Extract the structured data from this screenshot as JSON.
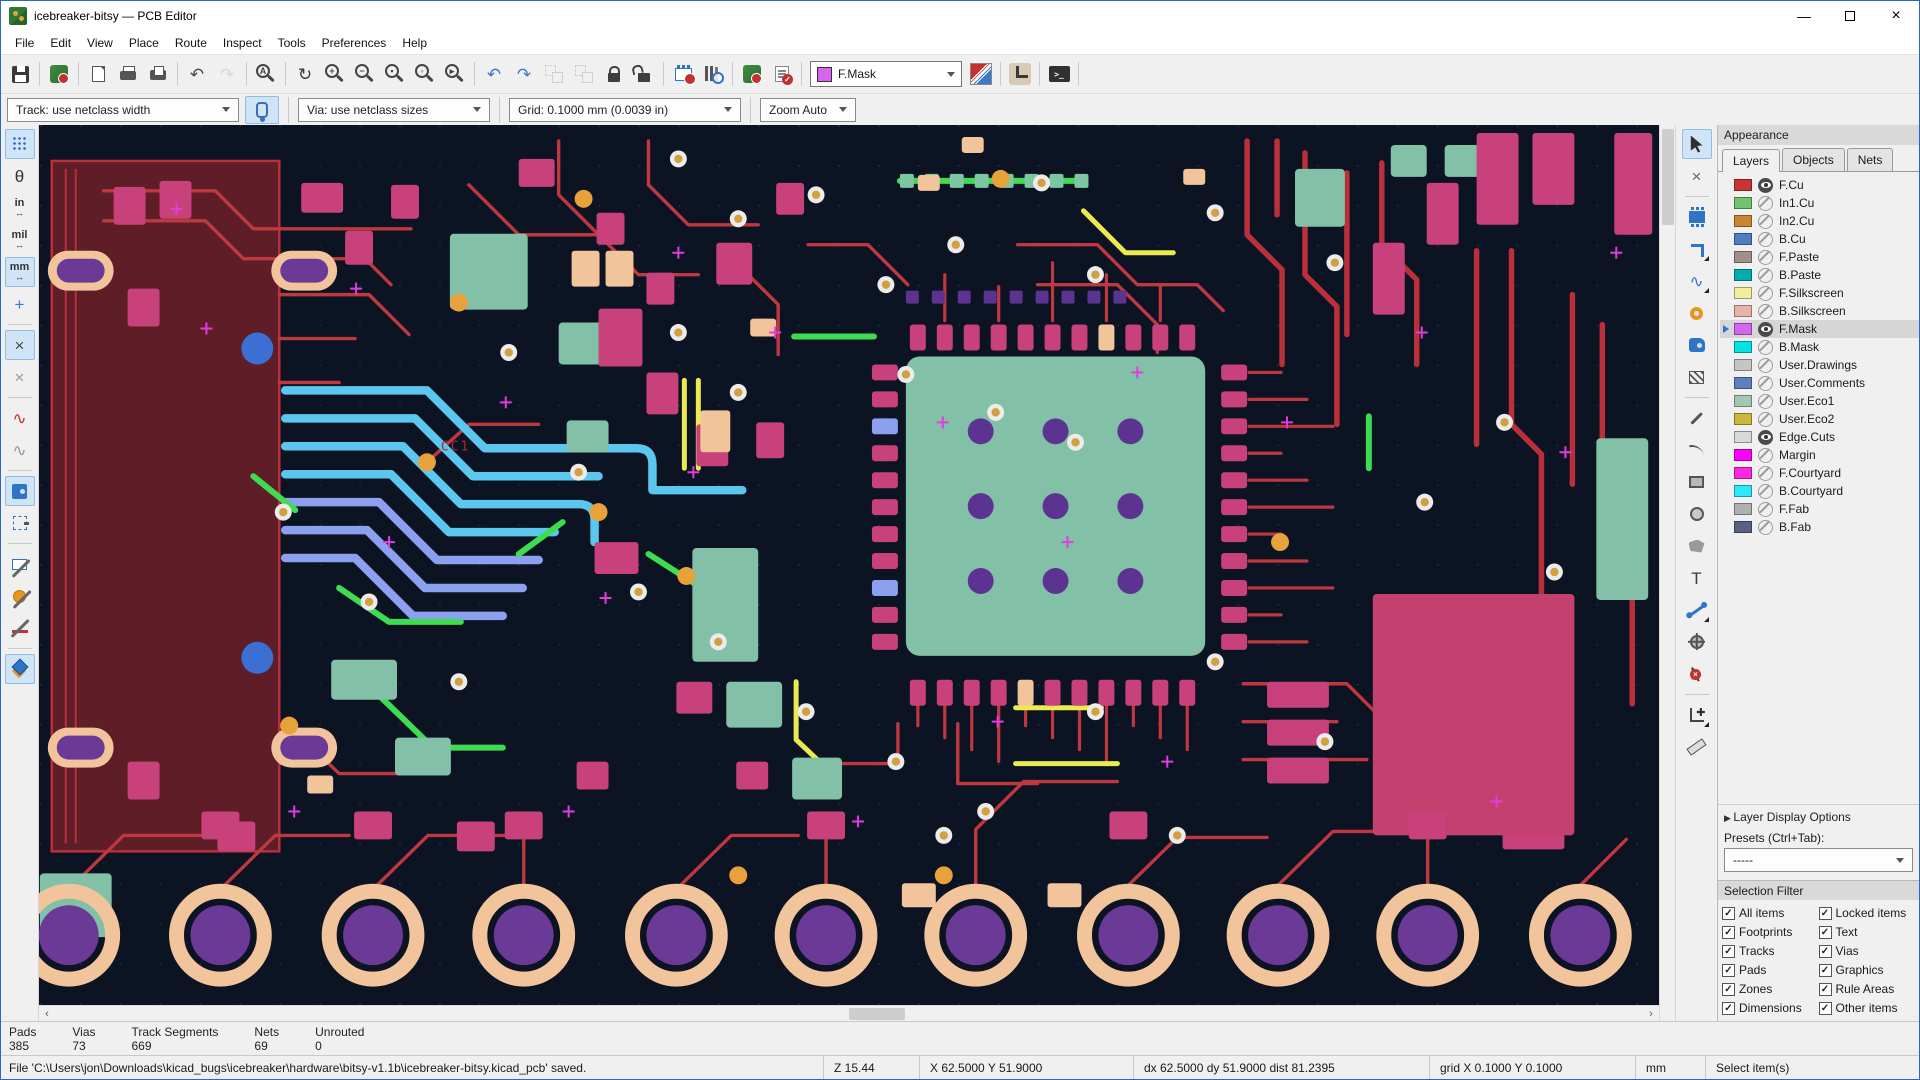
{
  "window": {
    "title": "icebreaker-bitsy — PCB Editor",
    "controls": {
      "minimize": "—",
      "close": "×"
    }
  },
  "menu": {
    "items": [
      "File",
      "Edit",
      "View",
      "Place",
      "Route",
      "Inspect",
      "Tools",
      "Preferences",
      "Help"
    ]
  },
  "toolbar": {
    "layer_selector": {
      "value": "F.Mask",
      "swatch_color": "#D564EE"
    },
    "groups_a": [
      [
        {
          "name": "save",
          "type": "floppy"
        }
      ],
      [
        {
          "name": "board-setup",
          "type": "board"
        }
      ],
      [
        {
          "name": "page-settings",
          "type": "page"
        },
        {
          "name": "print",
          "type": "print"
        },
        {
          "name": "plot",
          "type": "plot"
        }
      ],
      [
        {
          "name": "undo",
          "glyph": "↶",
          "color": "#4a4a4a"
        },
        {
          "name": "redo",
          "glyph": "↷",
          "color": "#bdbdbd",
          "disabled": true
        }
      ],
      [
        {
          "name": "search",
          "type": "zoom",
          "key": "A"
        }
      ],
      [
        {
          "name": "refresh-view",
          "glyph": "↻",
          "color": "#3a3a3a"
        },
        {
          "name": "zoom-in",
          "type": "zoom",
          "key": "+"
        },
        {
          "name": "zoom-out",
          "type": "zoom",
          "key": "−"
        },
        {
          "name": "zoom-fit-page",
          "type": "zoom",
          "key": "▪"
        },
        {
          "name": "zoom-fit-objects",
          "type": "zoom",
          "key": "◦"
        },
        {
          "name": "zoom-selection",
          "type": "zoom",
          "key": "▸"
        }
      ],
      [
        {
          "name": "rotate-ccw",
          "glyph": "↶",
          "color": "#3e78c8"
        },
        {
          "name": "rotate-cw",
          "glyph": "↷",
          "color": "#3e78c8"
        },
        {
          "name": "group-items",
          "type": "group",
          "disabled": true
        },
        {
          "name": "ungroup-items",
          "type": "group",
          "disabled": true
        },
        {
          "name": "lock",
          "type": "lock"
        },
        {
          "name": "unlock",
          "type": "unlock"
        }
      ],
      [
        {
          "name": "swap-footprints",
          "type": "fpswap"
        },
        {
          "name": "search-footprints",
          "type": "fplib"
        }
      ],
      [
        {
          "name": "update-pcb-from-schematic",
          "type": "board"
        },
        {
          "name": "drc-checker",
          "type": "drc"
        }
      ]
    ],
    "groups_b": [
      [
        {
          "name": "layer-pair",
          "type": "layerpair"
        }
      ],
      [
        {
          "name": "route-tracks-mode",
          "type": "route"
        }
      ],
      [
        {
          "name": "scripting-console",
          "type": "console"
        }
      ]
    ]
  },
  "settings_bar": {
    "track": "Track: use netclass width",
    "via": "Via: use netclass sizes",
    "grid": "Grid: 0.1000 mm (0.0039 in)",
    "zoom": "Zoom Auto"
  },
  "left_tools": [
    {
      "name": "toggle-grid",
      "type": "griddots",
      "active": true
    },
    {
      "name": "polar-coordinates",
      "glyph": "θ",
      "color": "#333"
    },
    {
      "name": "units-inches",
      "glyph": "in",
      "cls": "unit"
    },
    {
      "name": "units-mils",
      "glyph": "mil",
      "cls": "unit"
    },
    {
      "name": "units-mm",
      "glyph": "mm",
      "cls": "unit",
      "active": true
    },
    {
      "name": "crosshair-cursor",
      "glyph": "+",
      "color": "#3e78c8"
    },
    {
      "sep": true
    },
    {
      "name": "show-ratsnest",
      "glyph": "×",
      "color": "#4a4a4a",
      "active": true
    },
    {
      "name": "curved-ratsnest",
      "glyph": "×",
      "color": "#9a9a9a"
    },
    {
      "sep": true
    },
    {
      "name": "highlight-nets",
      "glyph": "∿",
      "color": "#c23030"
    },
    {
      "name": "net-color-mode",
      "glyph": "∿",
      "color": "#9a9a9a"
    },
    {
      "sep": true
    },
    {
      "name": "zone-fill-mode",
      "type": "zonefill",
      "active": true
    },
    {
      "name": "zone-outline-mode",
      "type": "zoneoutline"
    },
    {
      "sep": true
    },
    {
      "name": "hide-footprints",
      "type": "fpx",
      "cls": "slashed"
    },
    {
      "name": "sketch-pads-mode",
      "type": "padx",
      "cls": "slashed"
    },
    {
      "name": "sketch-tracks-mode",
      "type": "trackx",
      "cls": "slashed"
    },
    {
      "sep": true
    },
    {
      "name": "layers-manager",
      "type": "layers",
      "active": true
    }
  ],
  "right_tools": [
    {
      "name": "select-tool",
      "type": "cursorarrow",
      "active": true
    },
    {
      "name": "local-ratsnest",
      "glyph": "×",
      "color": "#666"
    },
    {
      "sep": true
    },
    {
      "name": "place-footprint",
      "type": "chip"
    },
    {
      "name": "route-tracks",
      "type": "elbow",
      "sub": true
    },
    {
      "name": "tune-track-length",
      "glyph": "∿",
      "color": "#3e78c8",
      "sub": true
    },
    {
      "name": "place-via",
      "type": "via"
    },
    {
      "name": "draw-zone",
      "type": "zone"
    },
    {
      "name": "rule-area",
      "type": "hatch"
    },
    {
      "sep": true
    },
    {
      "name": "draw-line",
      "type": "dline"
    },
    {
      "name": "draw-arc",
      "type": "darc"
    },
    {
      "name": "draw-rectangle",
      "type": "drect"
    },
    {
      "name": "draw-circle",
      "type": "dcircle"
    },
    {
      "name": "draw-polygon",
      "type": "dpoly"
    },
    {
      "name": "place-text",
      "glyph": "T",
      "color": "#3a3a3a"
    },
    {
      "name": "dimension",
      "type": "dim",
      "sub": true
    },
    {
      "name": "target-marker",
      "type": "target"
    },
    {
      "name": "delete-tool",
      "type": "deltool"
    },
    {
      "sep": true
    },
    {
      "name": "grid-origin",
      "type": "origin",
      "sub": true
    },
    {
      "name": "measure",
      "type": "ruler"
    }
  ],
  "appearance": {
    "title": "Appearance",
    "tabs": [
      "Layers",
      "Objects",
      "Nets"
    ],
    "active_tab": "Layers",
    "layers": [
      {
        "name": "F.Cu",
        "color": "#C83434",
        "visible": true
      },
      {
        "name": "In1.Cu",
        "color": "#72C26F",
        "visible": false
      },
      {
        "name": "In2.Cu",
        "color": "#C98530",
        "visible": false
      },
      {
        "name": "B.Cu",
        "color": "#4F7DC4",
        "visible": false
      },
      {
        "name": "F.Paste",
        "color": "#A09089",
        "visible": false
      },
      {
        "name": "B.Paste",
        "color": "#00ADAD",
        "visible": false
      },
      {
        "name": "F.Silkscreen",
        "color": "#F3EBA0",
        "visible": false
      },
      {
        "name": "B.Silkscreen",
        "color": "#E9B3A8",
        "visible": false
      },
      {
        "name": "F.Mask",
        "color": "#D564EE",
        "visible": true,
        "selected": true
      },
      {
        "name": "B.Mask",
        "color": "#02E3E3",
        "visible": false
      },
      {
        "name": "User.Drawings",
        "color": "#C5C5C5",
        "visible": false
      },
      {
        "name": "User.Comments",
        "color": "#5D80BC",
        "visible": false
      },
      {
        "name": "User.Eco1",
        "color": "#A5C6B4",
        "visible": false
      },
      {
        "name": "User.Eco2",
        "color": "#C9B83B",
        "visible": false
      },
      {
        "name": "Edge.Cuts",
        "color": "#D6DADA",
        "visible": true
      },
      {
        "name": "Margin",
        "color": "#FF00FF",
        "visible": false
      },
      {
        "name": "F.Courtyard",
        "color": "#FF26DF",
        "visible": false
      },
      {
        "name": "B.Courtyard",
        "color": "#2BE8FF",
        "visible": false
      },
      {
        "name": "F.Fab",
        "color": "#B0B0B0",
        "visible": false
      },
      {
        "name": "B.Fab",
        "color": "#5A5F84",
        "visible": false
      }
    ],
    "layer_display_options": "Layer Display Options",
    "presets_label": "Presets (Ctrl+Tab):",
    "presets_value": "-----"
  },
  "selection_filter": {
    "title": "Selection Filter",
    "items": [
      "All items",
      "Locked items",
      "Footprints",
      "Text",
      "Tracks",
      "Vias",
      "Pads",
      "Graphics",
      "Zones",
      "Rule Areas",
      "Dimensions",
      "Other items"
    ]
  },
  "board_stats": [
    {
      "label": "Pads",
      "value": "385"
    },
    {
      "label": "Vias",
      "value": "73"
    },
    {
      "label": "Track Segments",
      "value": "669"
    },
    {
      "label": "Nets",
      "value": "69"
    },
    {
      "label": "Unrouted",
      "value": "0"
    }
  ],
  "status_bar": {
    "message": "File 'C:\\Users\\jon\\Downloads\\kicad_bugs\\icebreaker\\hardware\\bitsy-v1.1b\\icebreaker-bitsy.kicad_pcb' saved.",
    "zoom": "Z 15.44",
    "position": "X 62.5000  Y 51.9000",
    "delta": "dx 62.5000  dy 51.9000  dist 81.2395",
    "grid": "grid X 0.1000  Y 0.1000",
    "units": "mm",
    "hint": "Select item(s)"
  },
  "canvas": {
    "reference_label": "CC1"
  }
}
